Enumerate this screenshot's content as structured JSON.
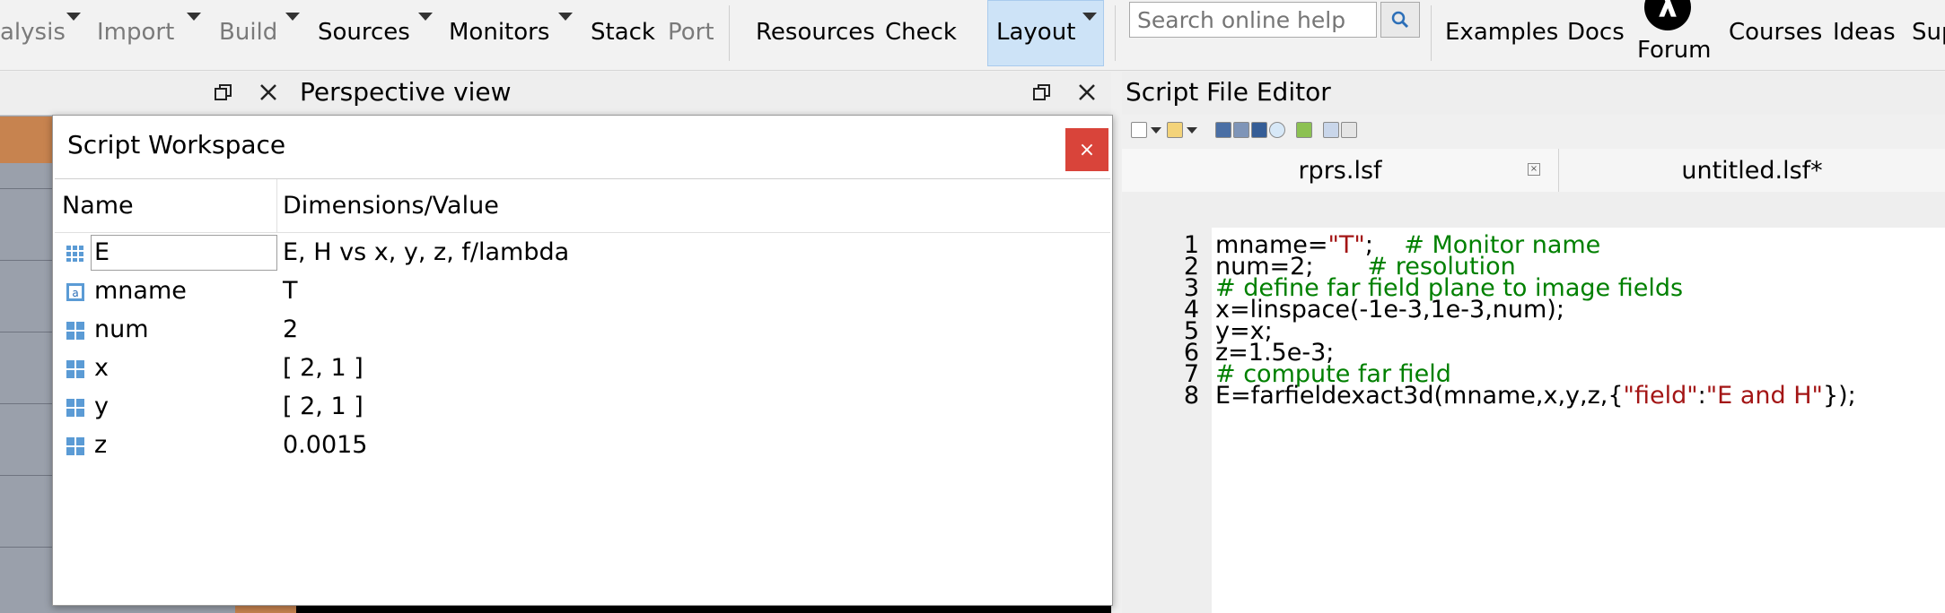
{
  "toolbar": {
    "items": [
      {
        "label": "alysis",
        "dim": true
      },
      {
        "label": "Import",
        "dim": true
      },
      {
        "label": "Build",
        "dim": true
      },
      {
        "label": "Sources",
        "dim": false
      },
      {
        "label": "Monitors",
        "dim": false
      },
      {
        "label": "Stack",
        "dim": false
      },
      {
        "label": "Port",
        "dim": true
      },
      {
        "label": "Resources",
        "dim": false
      },
      {
        "label": "Check",
        "dim": false
      },
      {
        "label": "Layout",
        "dim": false
      },
      {
        "label": "Examples",
        "dim": false
      },
      {
        "label": "Docs",
        "dim": false
      },
      {
        "label": "Forum",
        "dim": false
      },
      {
        "label": "Courses",
        "dim": false
      },
      {
        "label": "Ideas",
        "dim": false
      },
      {
        "label": "Sup",
        "dim": false
      }
    ],
    "search_placeholder": "Search online help",
    "forum_logo_glyph": "λ"
  },
  "panes": {
    "perspective_title": "Perspective view",
    "editor_title": "Script File Editor"
  },
  "workspace": {
    "title": "Script Workspace",
    "close_glyph": "×",
    "columns": [
      "Name",
      "Dimensions/Value"
    ],
    "rows": [
      {
        "name": "E",
        "value": "E, H vs x, y, z, f/lambda",
        "icon": "dataset-icon"
      },
      {
        "name": "mname",
        "value": "T",
        "icon": "string-variable-icon"
      },
      {
        "name": "num",
        "value": "2",
        "icon": "matrix-icon"
      },
      {
        "name": "x",
        "value": "[ 2, 1 ]",
        "icon": "matrix-icon"
      },
      {
        "name": "y",
        "value": "[ 2, 1 ]",
        "icon": "matrix-icon"
      },
      {
        "name": "z",
        "value": "0.0015",
        "icon": "matrix-icon"
      }
    ]
  },
  "editor": {
    "tabs": [
      {
        "label": "rprs.lsf",
        "active": true
      },
      {
        "label": "untitled.lsf*",
        "active": false
      }
    ],
    "lines": [
      {
        "n": "1",
        "parts": [
          [
            "",
            "mname="
          ],
          [
            "str",
            "\"T\""
          ],
          [
            "",
            ";    "
          ],
          [
            "cmt",
            "# Monitor name"
          ]
        ]
      },
      {
        "n": "2",
        "parts": [
          [
            "",
            "num=2;       "
          ],
          [
            "cmt",
            "# resolution"
          ]
        ]
      },
      {
        "n": "3",
        "parts": [
          [
            "cmt",
            "# define far field plane to image fields"
          ]
        ]
      },
      {
        "n": "4",
        "parts": [
          [
            "",
            "x=linspace(-1e-3,1e-3,num);"
          ]
        ]
      },
      {
        "n": "5",
        "parts": [
          [
            "",
            "y=x;"
          ]
        ]
      },
      {
        "n": "6",
        "parts": [
          [
            "",
            "z=1.5e-3;"
          ]
        ]
      },
      {
        "n": "7",
        "parts": [
          [
            "cmt",
            "# compute far field"
          ]
        ]
      },
      {
        "n": "8",
        "parts": [
          [
            "",
            "E=farfieldexact3d(mname,x,y,z,{"
          ],
          [
            "str",
            "\"field\""
          ],
          [
            "",
            ":"
          ],
          [
            "str",
            "\"E and H\""
          ],
          [
            "",
            "});"
          ]
        ]
      }
    ]
  },
  "colors": {
    "layout_active": "#cde3f7",
    "close_button": "#d9443a",
    "comment": "#008000",
    "string": "#a31515"
  }
}
